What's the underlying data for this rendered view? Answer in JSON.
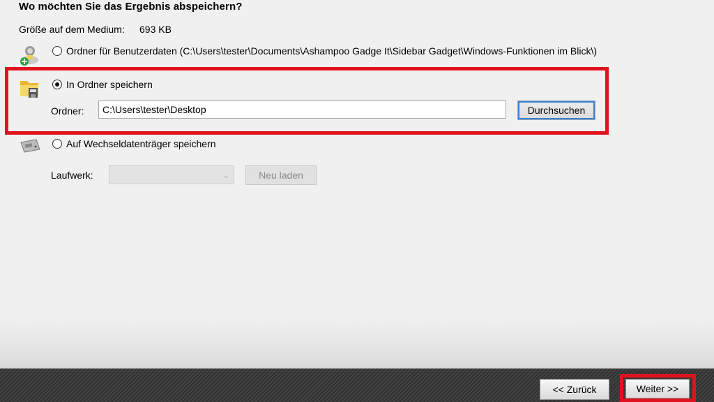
{
  "heading": "Wo möchten Sie das Ergebnis abspeichern?",
  "size": {
    "label": "Größe auf dem Medium:",
    "value": "693 KB"
  },
  "options": {
    "user_data": {
      "label": "Ordner für Benutzerdaten (C:\\Users\\tester\\Documents\\Ashampoo Gadge It\\Sidebar Gadget\\Windows-Funktionen im Blick\\)",
      "selected": false,
      "icon": "user-folder-add-icon"
    },
    "folder": {
      "label": "In Ordner speichern",
      "selected": true,
      "icon": "folder-save-icon"
    },
    "removable": {
      "label": "Auf Wechseldatenträger speichern",
      "selected": false,
      "icon": "removable-drive-icon"
    }
  },
  "folder_field": {
    "label": "Ordner:",
    "value": "C:\\Users\\tester\\Desktop",
    "browse_label": "Durchsuchen"
  },
  "drive_field": {
    "label": "Laufwerk:",
    "value": "",
    "reload_label": "Neu laden"
  },
  "footer": {
    "back_label": "<< Zurück",
    "next_label": "Weiter >>"
  },
  "colors": {
    "highlight": "#e0121d",
    "footer": "#3a3a3a",
    "focus": "#3b7fcf"
  }
}
